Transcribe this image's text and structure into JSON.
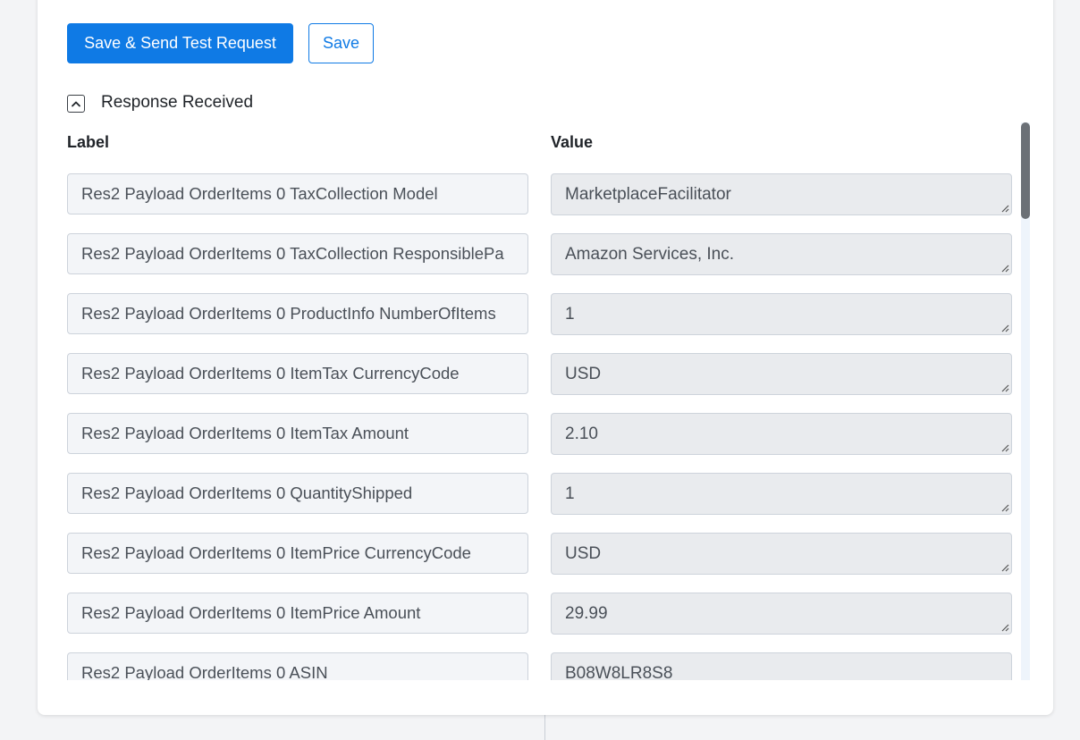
{
  "actions": {
    "save_send_label": "Save & Send Test Request",
    "save_label": "Save"
  },
  "response": {
    "section_title": "Response Received",
    "label_header": "Label",
    "value_header": "Value",
    "rows": [
      {
        "label": "Res2 Payload OrderItems 0 TaxCollection Model",
        "value": "MarketplaceFacilitator"
      },
      {
        "label": "Res2 Payload OrderItems 0 TaxCollection ResponsiblePa",
        "value": "Amazon Services, Inc."
      },
      {
        "label": "Res2 Payload OrderItems 0 ProductInfo NumberOfItems",
        "value": "1"
      },
      {
        "label": "Res2 Payload OrderItems 0 ItemTax CurrencyCode",
        "value": "USD"
      },
      {
        "label": "Res2 Payload OrderItems 0 ItemTax Amount",
        "value": "2.10"
      },
      {
        "label": "Res2 Payload OrderItems 0 QuantityShipped",
        "value": "1"
      },
      {
        "label": "Res2 Payload OrderItems 0 ItemPrice CurrencyCode",
        "value": "USD"
      },
      {
        "label": "Res2 Payload OrderItems 0 ItemPrice Amount",
        "value": "29.99"
      },
      {
        "label": "Res2 Payload OrderItems 0 ASIN",
        "value": "B08W8LR8S8"
      }
    ]
  }
}
